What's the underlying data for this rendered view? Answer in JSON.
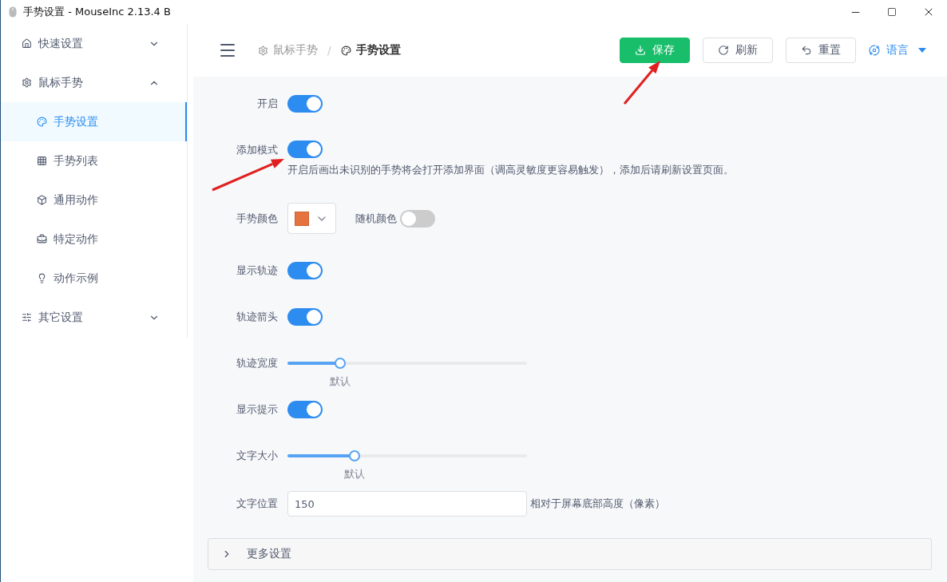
{
  "window": {
    "title": "手势设置 - MouseInc 2.13.4 B"
  },
  "sidebar": {
    "items": [
      {
        "label": "快速设置",
        "expanded": false
      },
      {
        "label": "鼠标手势",
        "expanded": true,
        "children": [
          {
            "label": "手势设置",
            "selected": true
          },
          {
            "label": "手势列表",
            "selected": false
          },
          {
            "label": "通用动作",
            "selected": false
          },
          {
            "label": "特定动作",
            "selected": false
          },
          {
            "label": "动作示例",
            "selected": false
          }
        ]
      },
      {
        "label": "其它设置",
        "expanded": false
      }
    ]
  },
  "breadcrumb": {
    "separator": "/",
    "items": [
      {
        "label": "鼠标手势",
        "current": false
      },
      {
        "label": "手势设置",
        "current": true
      }
    ]
  },
  "toolbar": [
    {
      "label": "保存",
      "kind": "primary"
    },
    {
      "label": "刷新",
      "kind": "default"
    },
    {
      "label": "重置",
      "kind": "default"
    },
    {
      "label": "语言",
      "kind": "dropdown"
    }
  ],
  "settings": [
    {
      "kind": "toggle",
      "label": "开启",
      "on": true
    },
    {
      "kind": "toggle",
      "label": "添加模式",
      "on": true,
      "hint": "开启后画出未识别的手势将会打开添加界面（调高灵敏度更容易触发），添加后请刷新设置页面。"
    },
    {
      "kind": "color",
      "label": "手势颜色",
      "color": "#e5733f",
      "extra_label": "随机颜色",
      "extra_on": false
    },
    {
      "kind": "toggle",
      "label": "显示轨迹",
      "on": true
    },
    {
      "kind": "toggle",
      "label": "轨迹箭头",
      "on": true
    },
    {
      "kind": "slider",
      "label": "轨迹宽度",
      "level": 0.22,
      "reading": "默认"
    },
    {
      "kind": "toggle",
      "label": "显示提示",
      "on": true
    },
    {
      "kind": "slider",
      "label": "文字大小",
      "level": 0.28,
      "reading": "默认"
    },
    {
      "kind": "input",
      "label": "文字位置",
      "value": "150",
      "suffix": "相对于屏幕底部高度（像素）"
    }
  ],
  "more_panel": {
    "label": "更多设置",
    "expanded": false
  }
}
